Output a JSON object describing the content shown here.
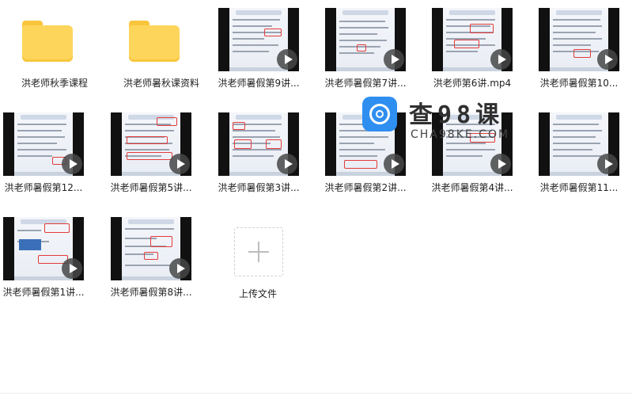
{
  "items": [
    {
      "type": "folder",
      "label": "洪老师秋季课程"
    },
    {
      "type": "folder",
      "label": "洪老师暑秋课资料"
    },
    {
      "type": "video",
      "label": "洪老师暑假第9讲..."
    },
    {
      "type": "video",
      "label": "洪老师暑假第7讲..."
    },
    {
      "type": "video",
      "label": "洪老师第6讲.mp4"
    },
    {
      "type": "video",
      "label": "洪老师暑假第10..."
    },
    {
      "type": "video",
      "label": "洪老师暑假第12..."
    },
    {
      "type": "video",
      "label": "洪老师暑假第5讲..."
    },
    {
      "type": "video",
      "label": "洪老师暑假第3讲..."
    },
    {
      "type": "video",
      "label": "洪老师暑假第2讲..."
    },
    {
      "type": "video",
      "label": "洪老师暑假第4讲..."
    },
    {
      "type": "video",
      "label": "洪老师暑假第11..."
    },
    {
      "type": "video",
      "label": "洪老师暑假第1讲..."
    },
    {
      "type": "video",
      "label": "洪老师暑假第8讲..."
    }
  ],
  "upload": {
    "label": "上传文件",
    "icon": "plus-icon"
  },
  "watermark": {
    "title": "查98课",
    "subtitle": "CHA98KE.COM"
  }
}
